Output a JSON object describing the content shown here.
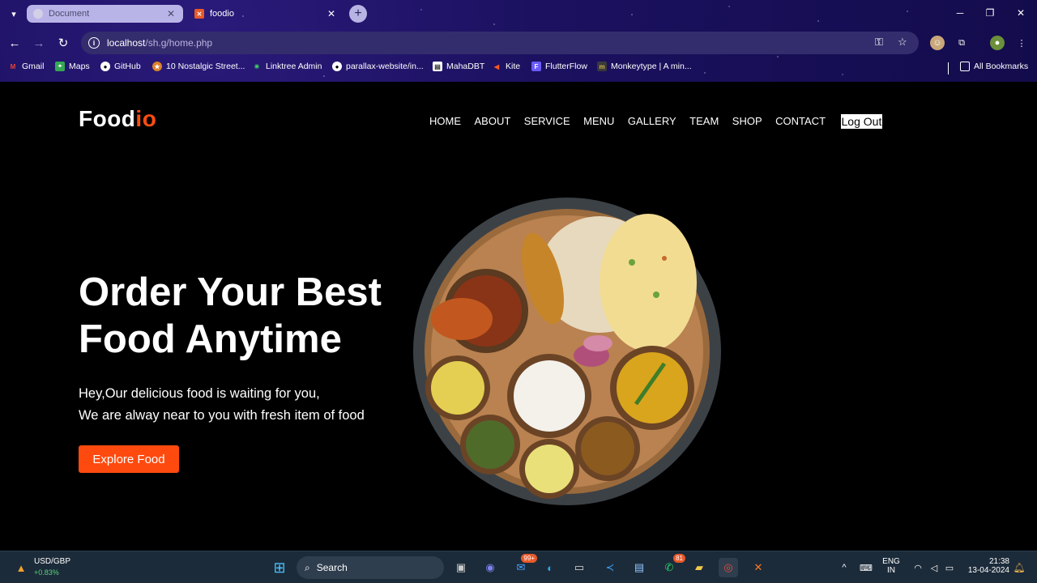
{
  "browser": {
    "tabs": [
      {
        "title": "Document",
        "active": false
      },
      {
        "title": "foodio",
        "active": true
      }
    ],
    "url_host": "localhost",
    "url_path": "/sh.g/home.php",
    "bookmarks": [
      {
        "label": "Gmail",
        "icon": "gmail-icon",
        "color": "#ea4335"
      },
      {
        "label": "Maps",
        "icon": "maps-icon",
        "color": "#34a853"
      },
      {
        "label": "GitHub",
        "icon": "github-icon",
        "color": "#ffffff"
      },
      {
        "label": "10 Nostalgic Street...",
        "icon": "nostalgic-icon",
        "color": "#d9822b"
      },
      {
        "label": "Linktree Admin",
        "icon": "linktree-icon",
        "color": "#43e660"
      },
      {
        "label": "parallax-website/in...",
        "icon": "github-icon",
        "color": "#ffffff"
      },
      {
        "label": "MahaDBT",
        "icon": "doc-icon",
        "color": "#ffffff"
      },
      {
        "label": "Kite",
        "icon": "kite-icon",
        "color": "#ff5722"
      },
      {
        "label": "FlutterFlow",
        "icon": "flutterflow-icon",
        "color": "#6a5af9"
      },
      {
        "label": "Monkeytype | A min...",
        "icon": "monkeytype-icon",
        "color": "#d1b349"
      }
    ],
    "all_bookmarks": "All Bookmarks"
  },
  "site": {
    "logo_main": "Food",
    "logo_accent": "io",
    "nav": [
      "HOME",
      "ABOUT",
      "SERVICE",
      "MENU",
      "GALLERY",
      "TEAM",
      "SHOP",
      "CONTACT"
    ],
    "logout": "Log Out",
    "hero_title": "Order Your Best Food Anytime",
    "hero_line1": "Hey,Our delicious food is waiting for you,",
    "hero_line2": "We are alway near to you with fresh item of food",
    "hero_button": "Explore Food",
    "accent_color": "#ff4a0f"
  },
  "taskbar": {
    "ticker_name": "USD/GBP",
    "ticker_change": "+0.83%",
    "search_placeholder": "Search",
    "mail_badge": "99+",
    "whatsapp_badge": "81",
    "lang_line1": "ENG",
    "lang_line2": "IN",
    "time": "21:38",
    "date": "13-04-2024"
  }
}
